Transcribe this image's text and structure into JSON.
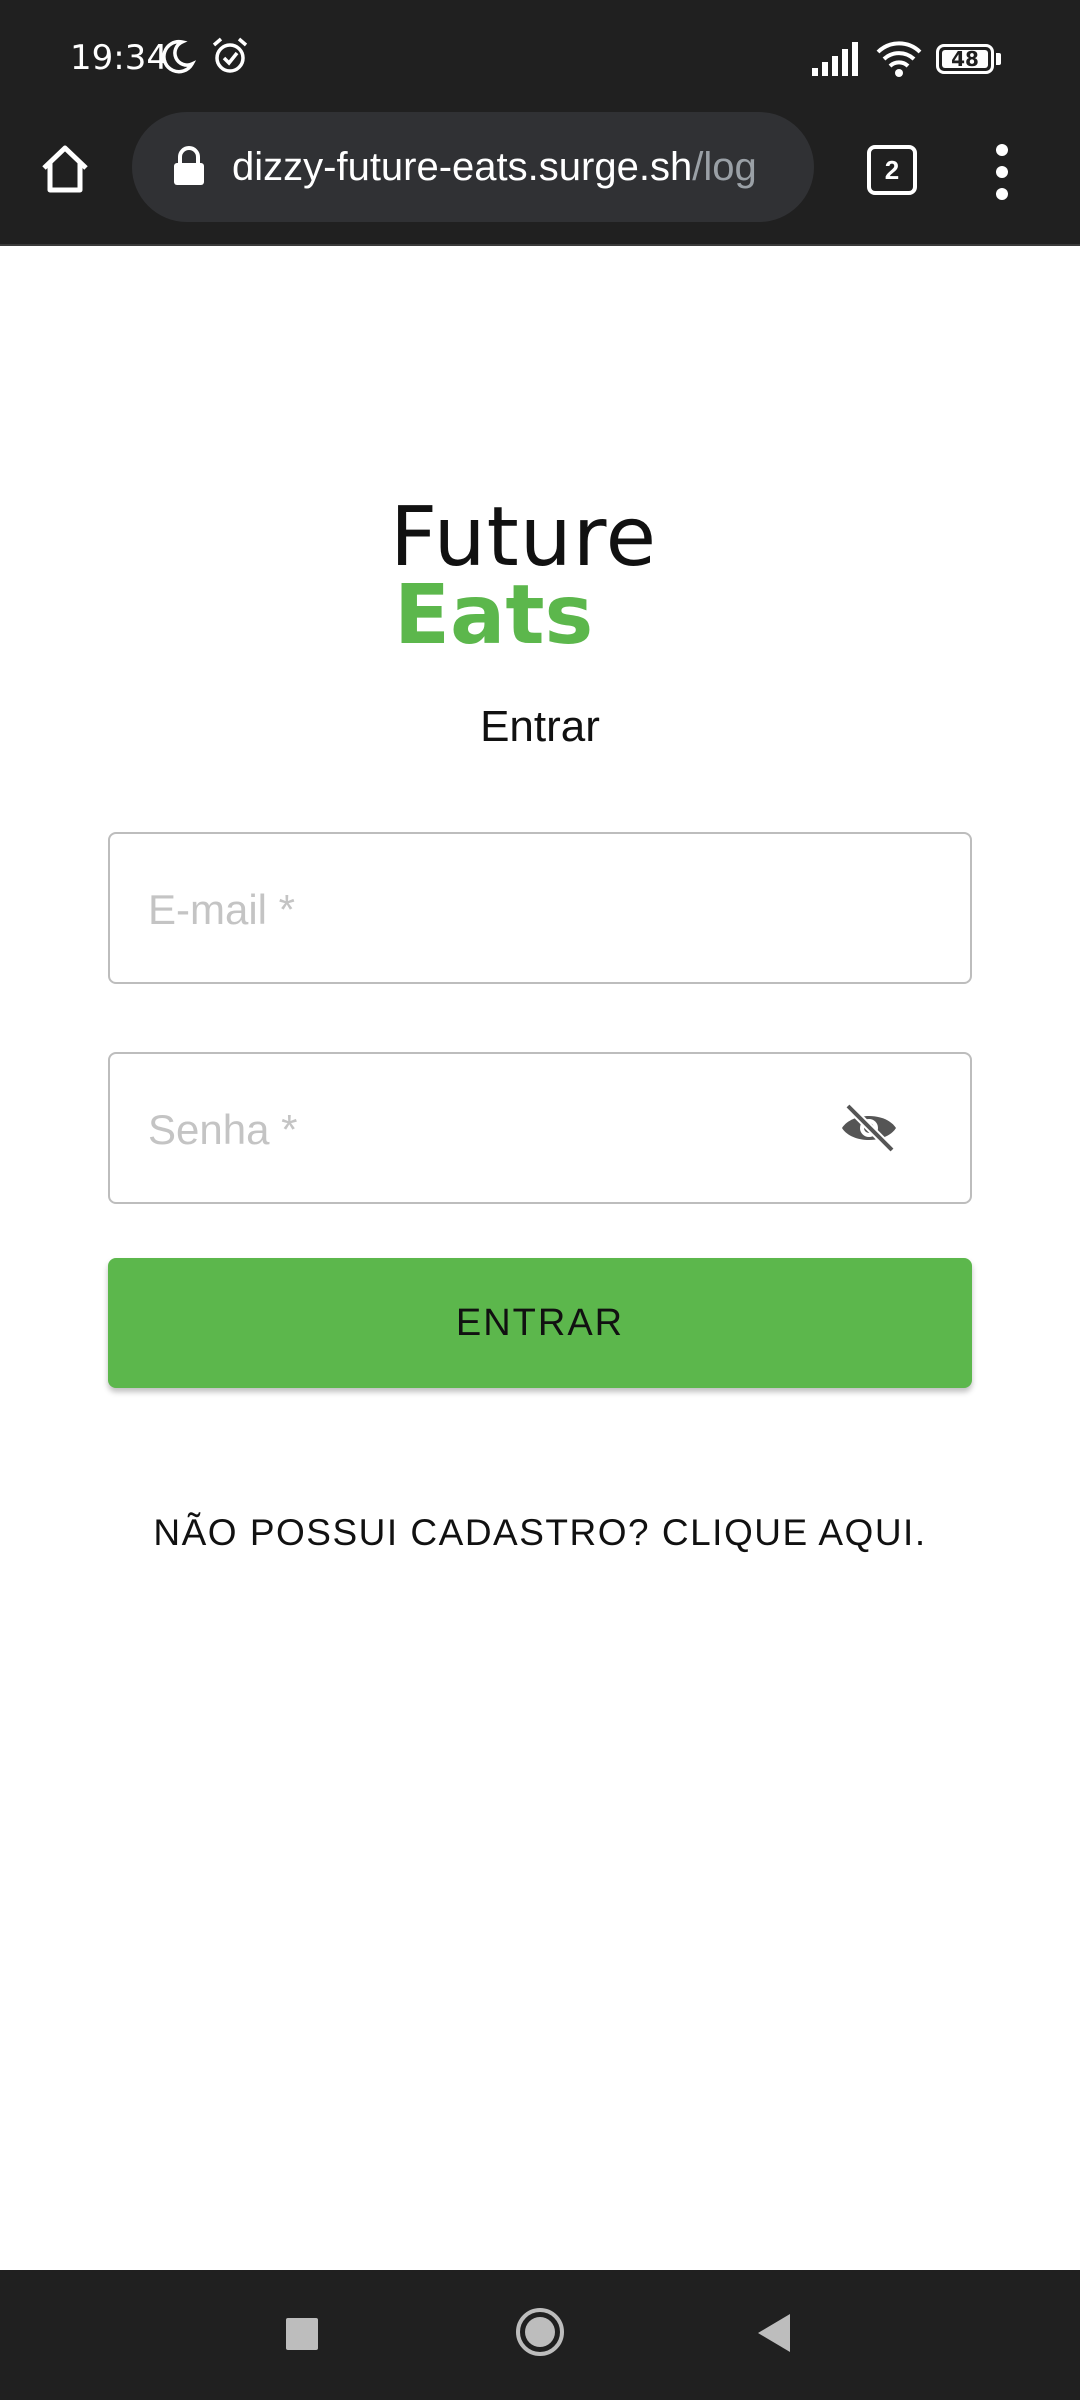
{
  "status_bar": {
    "time": "19:34",
    "battery": "48"
  },
  "browser": {
    "url_host": "dizzy-future-eats.surge.sh",
    "url_path": "/log",
    "tab_count": "2"
  },
  "page": {
    "logo_line1": "Future",
    "logo_line2": "Eats",
    "title": "Entrar",
    "email_placeholder": "E-mail *",
    "password_placeholder": "Senha *",
    "submit_label": "ENTRAR",
    "signup_link": "NÃO POSSUI CADASTRO? CLIQUE AQUI."
  },
  "colors": {
    "brand_green": "#5cb74c",
    "chrome_dark": "#202020"
  },
  "icons": [
    "moon-icon",
    "alarm-icon",
    "signal-icon",
    "wifi-icon",
    "battery-icon",
    "home-icon",
    "lock-icon",
    "tabs-icon",
    "more-menu-icon",
    "eye-off-icon",
    "nav-recents-icon",
    "nav-home-icon",
    "nav-back-icon"
  ]
}
